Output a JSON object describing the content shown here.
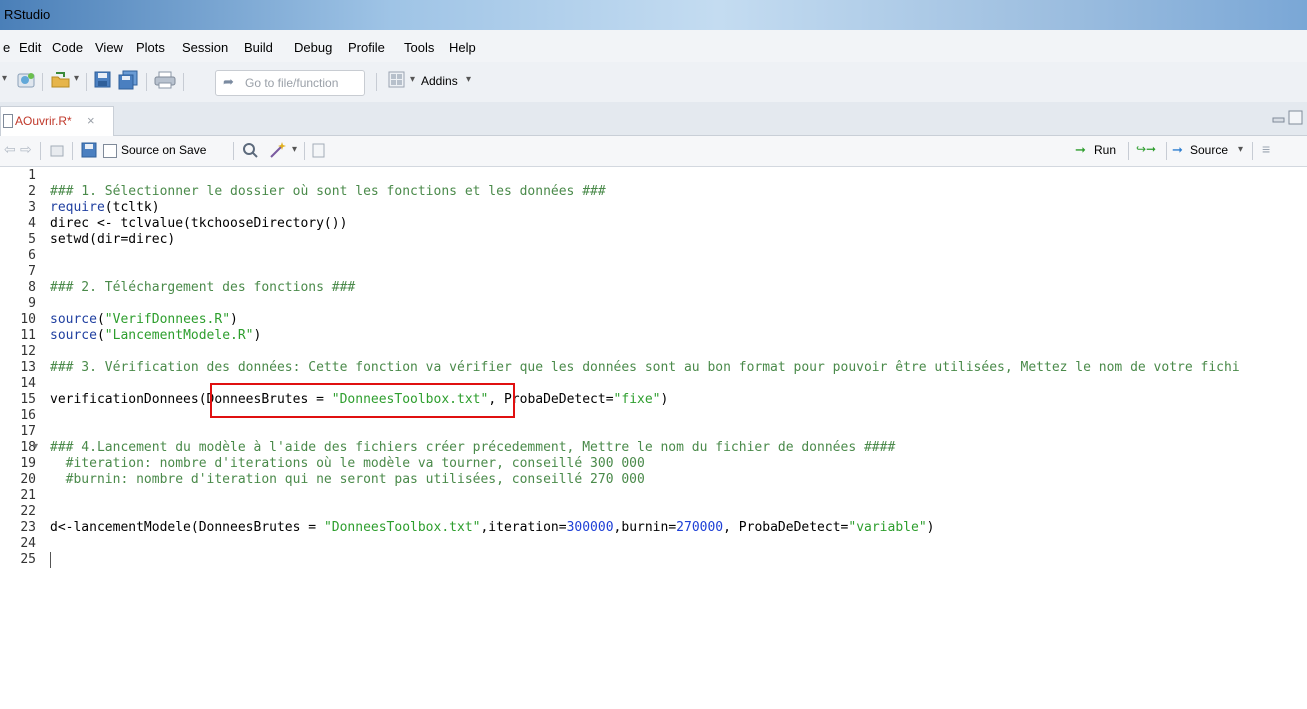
{
  "window": {
    "title": "RStudio"
  },
  "menu": [
    "e",
    "Edit",
    "Code",
    "View",
    "Plots",
    "Session",
    "Build",
    "Debug",
    "Profile",
    "Tools",
    "Help"
  ],
  "toolbar": {
    "goto_placeholder": "Go to file/function",
    "addins_label": "Addins"
  },
  "tab": {
    "name": "AOuvrir.R*",
    "close": "×"
  },
  "editor_toolbar": {
    "source_on_save": "Source on Save",
    "run_label": "Run",
    "source_label": "Source"
  },
  "line_numbers": [
    "1",
    "2",
    "3",
    "4",
    "5",
    "6",
    "7",
    "8",
    "9",
    "10",
    "11",
    "12",
    "13",
    "14",
    "15",
    "16",
    "17",
    "18",
    "19",
    "20",
    "21",
    "22",
    "23",
    "24",
    "25"
  ],
  "code": {
    "l2": "### 1. Sélectionner le dossier où sont les fonctions et les données ###",
    "l3_fn": "require",
    "l3_rest": "(tcltk)",
    "l4": "direc <- tclvalue(tkchooseDirectory())",
    "l5": "setwd(dir=direc)",
    "l8": "### 2. Téléchargement des fonctions ###",
    "l10_fn": "source",
    "l10_a": "(",
    "l10_str": "\"VerifDonnees.R\"",
    "l10_b": ")",
    "l11_fn": "source",
    "l11_a": "(",
    "l11_str": "\"LancementModele.R\"",
    "l11_b": ")",
    "l13": "### 3. Vérification des données: Cette fonction va vérifier que les données sont au bon format pour pouvoir être utilisées, Mettez le nom de votre fichi",
    "l15_a": "verificationDonnees(DonneesBrutes = ",
    "l15_str": "\"DonneesToolbox.txt\"",
    "l15_b": ", ProbaDeDetect=",
    "l15_str2": "\"fixe\"",
    "l15_c": ")",
    "l18": "### 4.Lancement du modèle à l'aide des fichiers créer précedemment, Mettre le nom du fichier de données ####",
    "l19": "  #iteration: nombre d'iterations où le modèle va tourner, conseillé 300 000",
    "l20": "  #burnin: nombre d'iteration qui ne seront pas utilisées, conseillé 270 000",
    "l23_a": "d<-lancementModele(DonneesBrutes = ",
    "l23_str": "\"DonneesToolbox.txt\"",
    "l23_b": ",iteration=",
    "l23_n1": "300000",
    "l23_c": ",burnin=",
    "l23_n2": "270000",
    "l23_d": ", ProbaDeDetect=",
    "l23_str2": "\"variable\"",
    "l23_e": ")"
  },
  "colors": {
    "comment": "#4a8a4a",
    "function": "#1f3fa0",
    "string": "#2d9e2d",
    "number": "#1d3fd6",
    "highlight_box": "#e01010"
  }
}
